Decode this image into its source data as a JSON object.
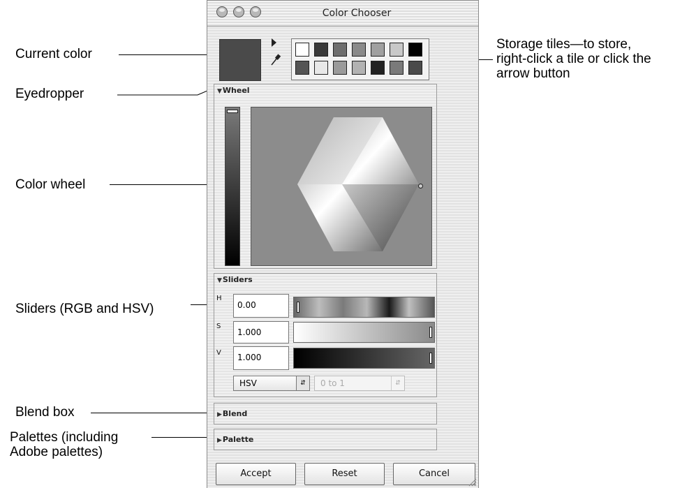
{
  "callouts": {
    "current_color": "Current color",
    "eyedropper": "Eyedropper",
    "color_wheel": "Color wheel",
    "sliders": "Sliders (RGB and HSV)",
    "blend_box": "Blend box",
    "palettes_line1": "Palettes (including",
    "palettes_line2": "Adobe palettes)",
    "storage_line1": "Storage tiles—to store,",
    "storage_line2": "right-click a tile or click the",
    "storage_line3": "arrow button"
  },
  "window": {
    "title": "Color Chooser"
  },
  "current_color": "#4a4a4a",
  "storage_tiles": {
    "row1": [
      "#ffffff",
      "#3a3a3a",
      "#6e6e6e",
      "#8a8a8a",
      "#a0a0a0",
      "#c8c8c8",
      "#000000"
    ],
    "row2": [
      "#555555",
      "#e8e8e8",
      "#9a9a9a",
      "#b2b2b2",
      "#222222",
      "#7a7a7a",
      "#4a4a4a"
    ]
  },
  "sections": {
    "wheel": "Wheel",
    "sliders": "Sliders",
    "blend": "Blend",
    "palette": "Palette"
  },
  "sliders": {
    "h_label": "H",
    "h_value": "0.00",
    "s_label": "S",
    "s_value": "1.000",
    "v_label": "V",
    "v_value": "1.000",
    "mode": "HSV",
    "range": "0 to 1"
  },
  "buttons": {
    "accept": "Accept",
    "reset": "Reset",
    "cancel": "Cancel"
  }
}
